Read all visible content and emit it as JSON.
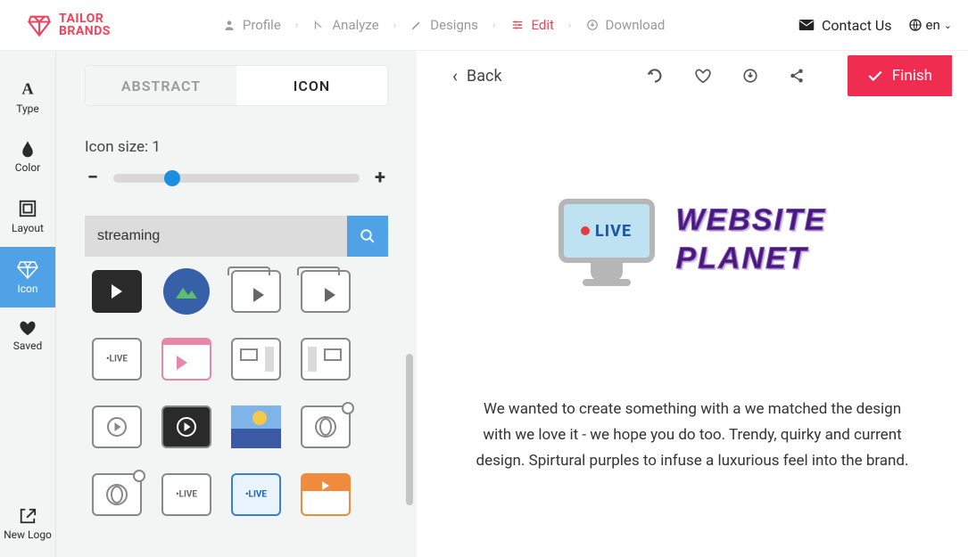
{
  "brand": {
    "line1": "TAILOR",
    "line2": "BRANDS"
  },
  "nav": {
    "profile": "Profile",
    "analyze": "Analyze",
    "designs": "Designs",
    "edit": "Edit",
    "download": "Download"
  },
  "header": {
    "contact": "Contact Us",
    "lang": "en"
  },
  "rail": {
    "type": "Type",
    "color": "Color",
    "layout": "Layout",
    "icon": "Icon",
    "saved": "Saved",
    "newlogo": "New Logo"
  },
  "panel": {
    "tab_abstract": "ABSTRACT",
    "tab_icon": "ICON",
    "size_label": "Icon size: 1",
    "icon_size_value": 1,
    "search_value": "streaming"
  },
  "toolbar": {
    "back": "Back",
    "finish": "Finish"
  },
  "preview": {
    "live": "LIVE",
    "brand_line1": "WEBSITE",
    "brand_line2": "PLANET"
  },
  "description": "We wanted to create something with a we matched the design with we love it - we hope you do too. Trendy, quirky and current design. Spirtural purples to infuse a luxurious feel into the brand.",
  "colors": {
    "accent": "#f04359",
    "primary_blue": "#4ea2e5",
    "finish": "#ee2d51",
    "brand_purple": "#4a1878"
  }
}
